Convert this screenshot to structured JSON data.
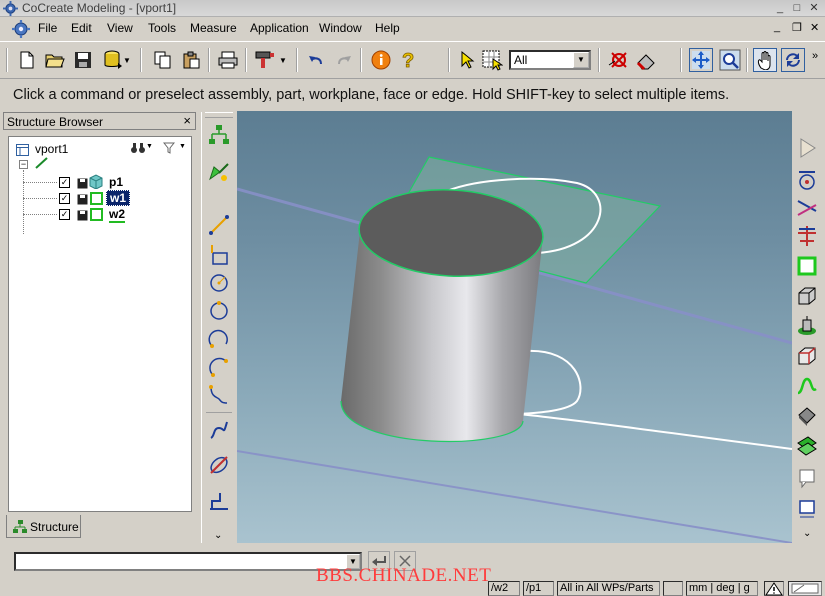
{
  "window": {
    "title": "CoCreate Modeling - [vport1]",
    "controls": [
      "_",
      "□",
      "✕"
    ],
    "mdi_controls": [
      "_",
      "❐",
      "✕"
    ]
  },
  "menu": {
    "file": "File",
    "edit": "Edit",
    "view": "View",
    "tools": "Tools",
    "measure": "Measure",
    "application": "Application",
    "window": "Window",
    "help": "Help"
  },
  "toolbar": {
    "filter_value": "All"
  },
  "prompt": "Click a command or preselect assembly, part, workplane, face or edge. Hold SHIFT-key to select multiple items.",
  "structure_browser": {
    "title": "Structure Browser",
    "close": "×",
    "root": "vport1",
    "items": [
      {
        "label": "p1"
      },
      {
        "label": "w1"
      },
      {
        "label": "w2"
      }
    ],
    "tab_label": "Structure"
  },
  "command_line": {
    "value": ""
  },
  "statusbar": {
    "wp": "/w2",
    "part": "/p1",
    "filter": "All in All WPs/Parts",
    "units": "mm | deg | g"
  },
  "watermark": "BBS.CHINADE.NET",
  "colors": {
    "accent": "#0a246a",
    "workplane_green": "#22cc66",
    "viewport_top": "#5c7d92",
    "viewport_bottom": "#a9c3cf"
  }
}
